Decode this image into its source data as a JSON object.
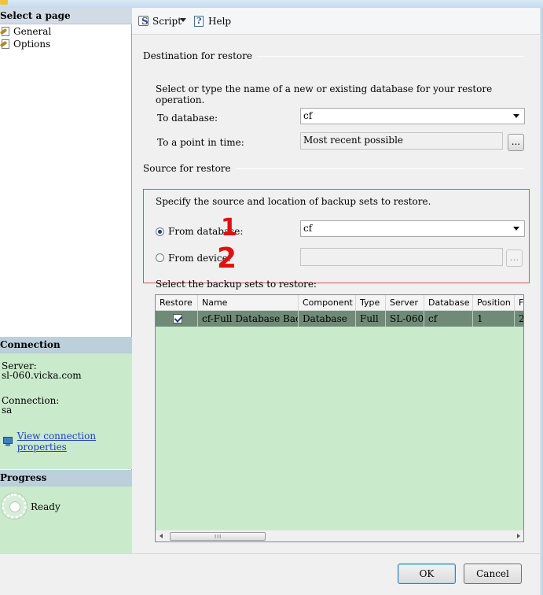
{
  "left_pane": {
    "select_page_header": "Select a page",
    "pages": [
      {
        "label": "General",
        "icon": "page-wrench-icon"
      },
      {
        "label": "Options",
        "icon": "page-wrench-icon"
      }
    ],
    "connection": {
      "header": "Connection",
      "server_label": "Server:",
      "server_value": "sl-060.vicka.com",
      "connection_label": "Connection:",
      "connection_value": "sa",
      "view_properties_link": "View connection properties"
    },
    "progress": {
      "header": "Progress",
      "status": "Ready"
    }
  },
  "toolbar": {
    "script_label": "Script",
    "help_label": "Help"
  },
  "destination": {
    "group_label": "Destination for restore",
    "instruction": "Select or type the name of a new or existing database for your restore operation.",
    "to_database_label": "To database:",
    "to_database_value": "cf",
    "point_in_time_label": "To a point in time:",
    "point_in_time_value": "Most recent possible",
    "ellipsis": "..."
  },
  "source": {
    "group_label": "Source for restore",
    "instruction": "Specify the source and location of backup sets to restore.",
    "from_database_label": "From database:",
    "from_database_value": "cf",
    "from_device_label": "From device:",
    "from_device_value": "",
    "ellipsis": "...",
    "annotation_1": "1",
    "annotation_2": "2"
  },
  "backup_sets": {
    "label": "Select the backup sets to restore:",
    "columns": [
      "Restore",
      "Name",
      "Component",
      "Type",
      "Server",
      "Database",
      "Position",
      "F"
    ],
    "rows": [
      {
        "restore": true,
        "name": "cf-Full Database Backup",
        "component": "Database",
        "type": "Full",
        "server": "SL-060",
        "database": "cf",
        "position": "1",
        "first": "2"
      }
    ],
    "scroll_grip": "III"
  },
  "buttons": {
    "ok": "OK",
    "cancel": "Cancel"
  },
  "colors": {
    "annotation": "#e01010",
    "green_panel": "#c9eacb",
    "selected_row": "#6f8b78"
  }
}
